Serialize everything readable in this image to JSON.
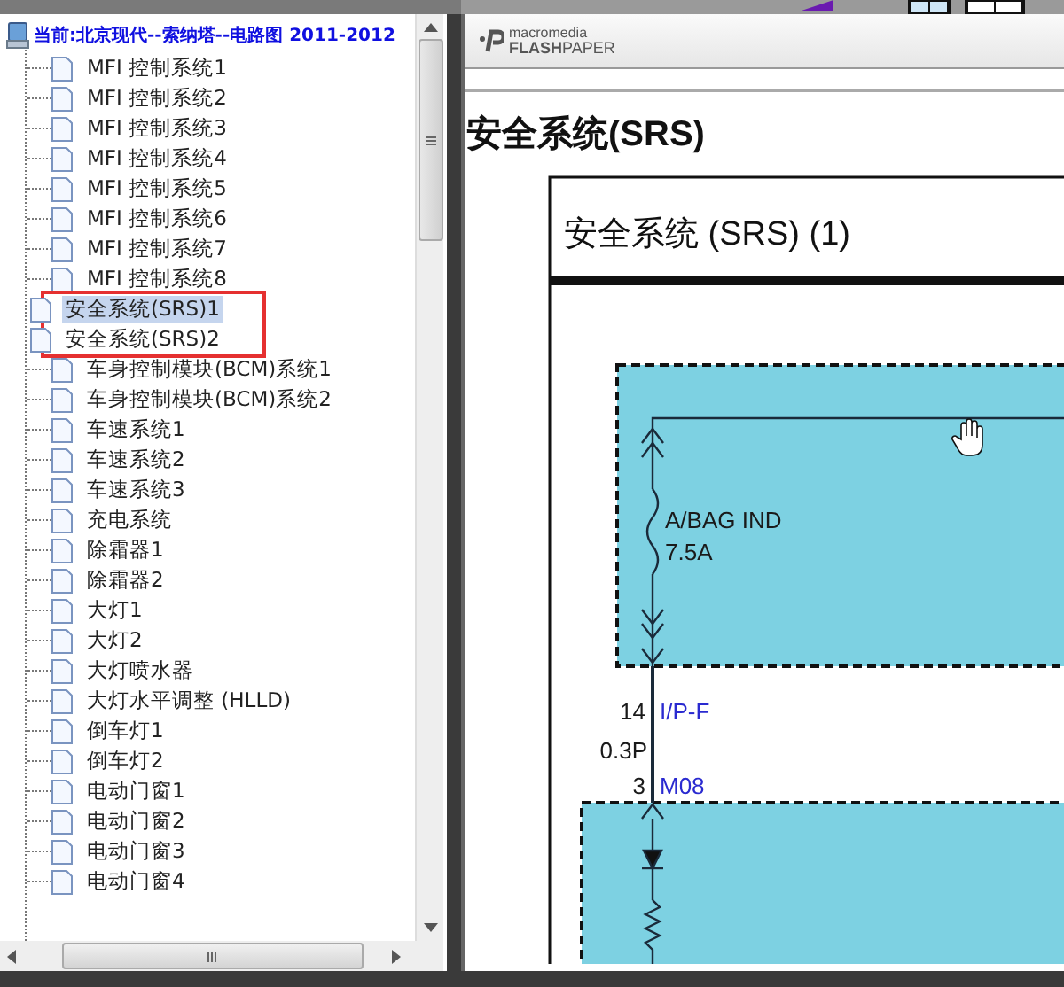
{
  "tree": {
    "root": "当前:北京现代--索纳塔--电路图 2011-2012",
    "items": [
      {
        "label": "MFI 控制系统1",
        "selected": false,
        "boxed": false
      },
      {
        "label": "MFI 控制系统2",
        "selected": false,
        "boxed": false
      },
      {
        "label": "MFI 控制系统3",
        "selected": false,
        "boxed": false
      },
      {
        "label": "MFI 控制系统4",
        "selected": false,
        "boxed": false
      },
      {
        "label": "MFI 控制系统5",
        "selected": false,
        "boxed": false
      },
      {
        "label": "MFI 控制系统6",
        "selected": false,
        "boxed": false
      },
      {
        "label": "MFI 控制系统7",
        "selected": false,
        "boxed": false
      },
      {
        "label": "MFI 控制系统8",
        "selected": false,
        "boxed": false
      },
      {
        "label": "安全系统(SRS)1",
        "selected": true,
        "boxed": true
      },
      {
        "label": "安全系统(SRS)2",
        "selected": false,
        "boxed": true
      },
      {
        "label": "车身控制模块(BCM)系统1",
        "selected": false,
        "boxed": false
      },
      {
        "label": "车身控制模块(BCM)系统2",
        "selected": false,
        "boxed": false
      },
      {
        "label": "车速系统1",
        "selected": false,
        "boxed": false
      },
      {
        "label": "车速系统2",
        "selected": false,
        "boxed": false
      },
      {
        "label": "车速系统3",
        "selected": false,
        "boxed": false
      },
      {
        "label": "充电系统",
        "selected": false,
        "boxed": false
      },
      {
        "label": "除霜器1",
        "selected": false,
        "boxed": false
      },
      {
        "label": "除霜器2",
        "selected": false,
        "boxed": false
      },
      {
        "label": "大灯1",
        "selected": false,
        "boxed": false
      },
      {
        "label": "大灯2",
        "selected": false,
        "boxed": false
      },
      {
        "label": "大灯喷水器",
        "selected": false,
        "boxed": false
      },
      {
        "label": "大灯水平调整 (HLLD)",
        "selected": false,
        "boxed": false
      },
      {
        "label": "倒车灯1",
        "selected": false,
        "boxed": false
      },
      {
        "label": "倒车灯2",
        "selected": false,
        "boxed": false
      },
      {
        "label": "电动门窗1",
        "selected": false,
        "boxed": false
      },
      {
        "label": "电动门窗2",
        "selected": false,
        "boxed": false
      },
      {
        "label": "电动门窗3",
        "selected": false,
        "boxed": false
      },
      {
        "label": "电动门窗4",
        "selected": false,
        "boxed": false
      }
    ]
  },
  "viewer": {
    "logo_top": "macromedia",
    "logo_bottom": "**FLASH**PAPER",
    "heading": "安全系统(SRS)",
    "diagram": {
      "title": "安全系统 (SRS) (1)",
      "labels": [
        {
          "text": "A/BAG IND",
          "color": "#1a1a1a"
        },
        {
          "text": "7.5A",
          "color": "#1a1a1a"
        },
        {
          "text": "14",
          "color": "#1a1a1a"
        },
        {
          "text": "I/P-F",
          "color": "#2a2ad0"
        },
        {
          "text": "0.3P",
          "color": "#1a1a1a"
        },
        {
          "text": "3",
          "color": "#1a1a1a"
        },
        {
          "text": "M08",
          "color": "#2a2ad0"
        }
      ]
    }
  }
}
